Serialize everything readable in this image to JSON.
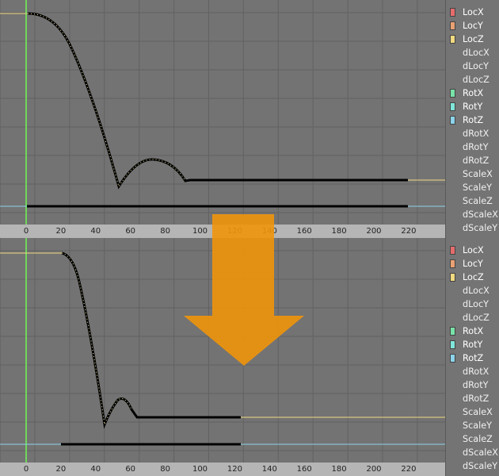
{
  "ruler_ticks": [
    "0",
    "20",
    "40",
    "60",
    "80",
    "100",
    "120",
    "140",
    "160",
    "180",
    "200",
    "220"
  ],
  "channels": [
    {
      "label": "LocX",
      "color": "#e66c6c",
      "swatch": true
    },
    {
      "label": "LocY",
      "color": "#e9a073",
      "swatch": true
    },
    {
      "label": "LocZ",
      "color": "#f0d980",
      "swatch": true
    },
    {
      "label": "dLocX",
      "swatch": false
    },
    {
      "label": "dLocY",
      "swatch": false
    },
    {
      "label": "dLocZ",
      "swatch": false
    },
    {
      "label": "RotX",
      "color": "#78e3a8",
      "swatch": true
    },
    {
      "label": "RotY",
      "color": "#7fe6d9",
      "swatch": true
    },
    {
      "label": "RotZ",
      "color": "#8cd3ea",
      "swatch": true
    },
    {
      "label": "dRotX",
      "swatch": false
    },
    {
      "label": "dRotY",
      "swatch": false
    },
    {
      "label": "dRotZ",
      "swatch": false
    },
    {
      "label": "ScaleX",
      "swatch": false
    },
    {
      "label": "ScaleY",
      "swatch": false
    },
    {
      "label": "ScaleZ",
      "swatch": false
    },
    {
      "label": "dScaleX",
      "swatch": false
    },
    {
      "label": "dScaleY",
      "swatch": false
    }
  ],
  "colors": {
    "background": "#737373",
    "grid": "#626262",
    "current_frame": "#6fd65b",
    "curve": "#000000",
    "locz_extrapolation": "#f0d980",
    "rotz_extrapolation": "#8cd3ea",
    "arrow": "#f0950a",
    "ruler": "#b5b5b5"
  }
}
